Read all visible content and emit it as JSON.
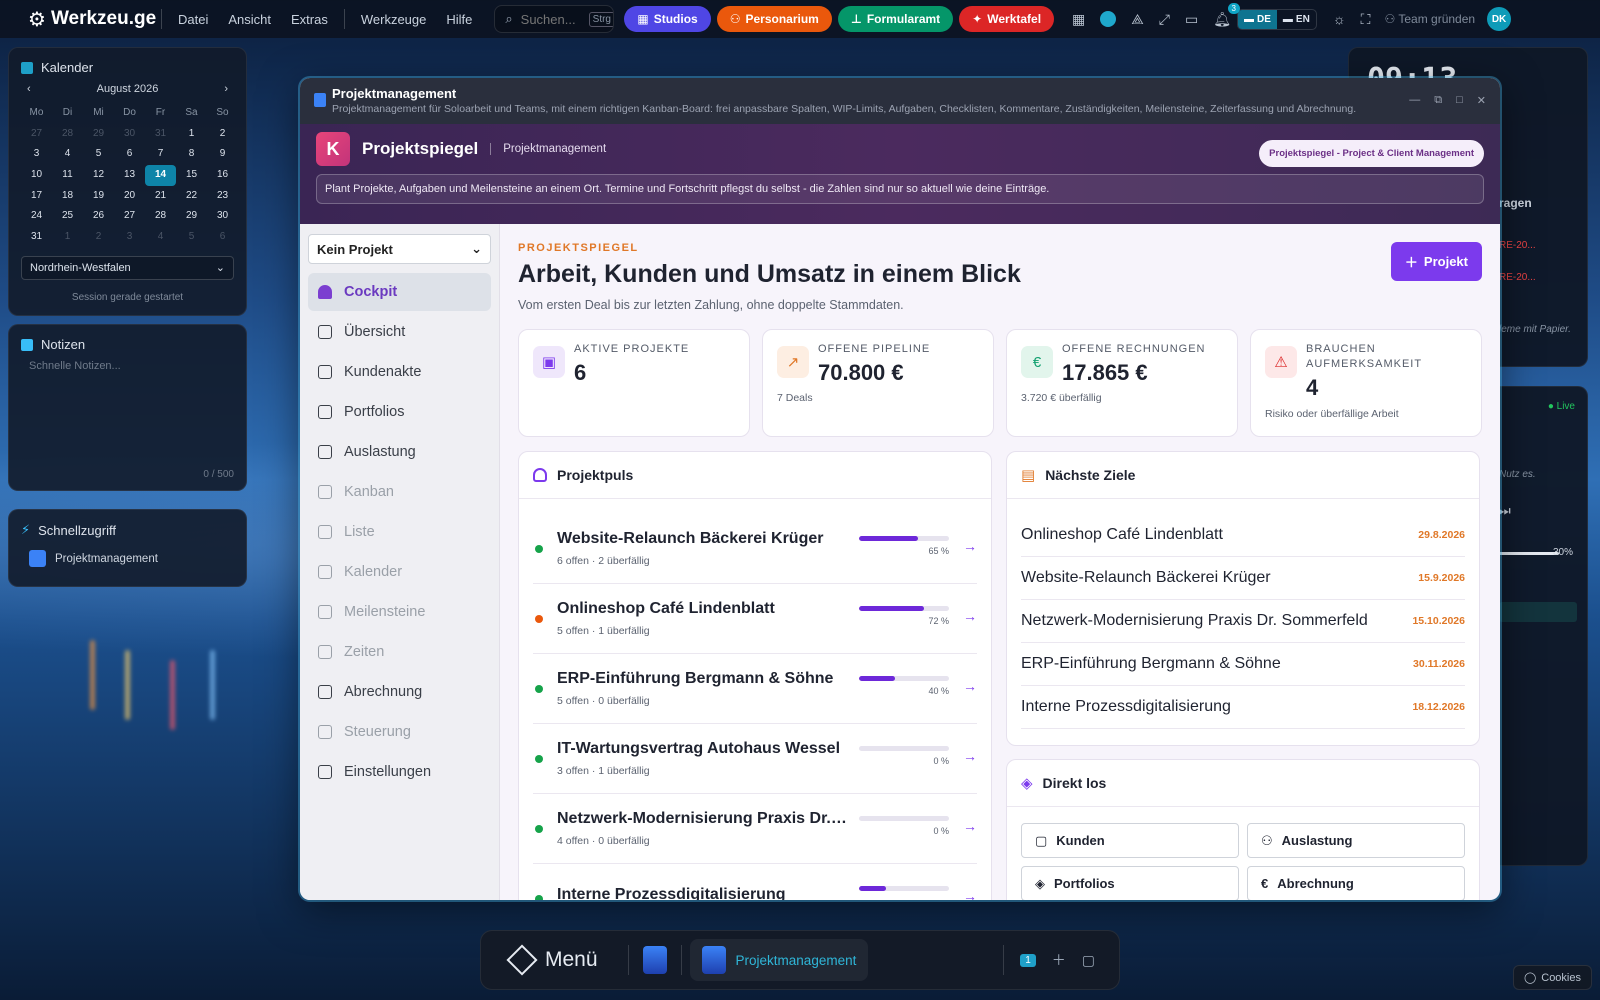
{
  "topbar": {
    "logo": "Werkzeu.ge",
    "menu": [
      "Datei",
      "Ansicht",
      "Extras",
      "Werkzeuge",
      "Hilfe"
    ],
    "search_placeholder": "Suchen...",
    "search_kbd": "Strg",
    "pills": [
      {
        "label": "Studios",
        "color": "#4f46e5"
      },
      {
        "label": "Personarium",
        "color": "#ea580c"
      },
      {
        "label": "Formularamt",
        "color": "#059669"
      },
      {
        "label": "Werktafel",
        "color": "#dc2626"
      }
    ],
    "notification_count": "3",
    "lang_de": "DE",
    "lang_en": "EN",
    "team": "Team gründen",
    "avatar": "DK"
  },
  "calendar": {
    "title": "Kalender",
    "month": "August 2026",
    "weekdays": [
      "Mo",
      "Di",
      "Mi",
      "Do",
      "Fr",
      "Sa",
      "So"
    ],
    "days": [
      "27",
      "28",
      "29",
      "30",
      "31",
      "1",
      "2",
      "3",
      "4",
      "5",
      "6",
      "7",
      "8",
      "9",
      "10",
      "11",
      "12",
      "13",
      "14",
      "15",
      "16",
      "17",
      "18",
      "19",
      "20",
      "21",
      "22",
      "23",
      "24",
      "25",
      "26",
      "27",
      "28",
      "29",
      "30",
      "31",
      "1",
      "2",
      "3",
      "4",
      "5",
      "6"
    ],
    "today": "14",
    "region": "Nordrhein-Westfalen",
    "session": "Session gerade gestartet"
  },
  "notes": {
    "title": "Notizen",
    "placeholder": "Schnelle Notizen...",
    "count": "0 / 500"
  },
  "quickaccess": {
    "title": "Schnellzugriff",
    "item": "Projektmanagement"
  },
  "right_panels": {
    "clock": "09:13",
    "fragment1": "ragen",
    "re1": "RE-20...",
    "re2": "RE-20...",
    "paper": "leme mit Papier.",
    "live": "Live",
    "nutz": "Nutz es.",
    "vol": "30%"
  },
  "window": {
    "title": "Projektmanagement",
    "subtitle": "Projektmanagement für Soloarbeit und Teams, mit einem richtigen Kanban-Board: frei anpassbare Spalten, WIP-Limits, Aufgaben, Checklisten, Kommentare, Zuständigkeiten, Meilensteine, Zeiterfassung und Abrechnung."
  },
  "app": {
    "logo_letter": "K",
    "name": "Projektspiegel",
    "section": "Projektmanagement",
    "badge": "Projektspiegel - Project & Client Management",
    "info": "Plant Projekte, Aufgaben und Meilensteine an einem Ort. Termine und Fortschritt pflegst du selbst - die Zahlen sind nur so aktuell wie deine Einträge."
  },
  "sidebar": {
    "project_select": "Kein Projekt",
    "items": [
      {
        "label": "Cockpit",
        "state": "active"
      },
      {
        "label": "Übersicht",
        "state": "normal"
      },
      {
        "label": "Kundenakte",
        "state": "normal"
      },
      {
        "label": "Portfolios",
        "state": "normal"
      },
      {
        "label": "Auslastung",
        "state": "normal"
      },
      {
        "label": "Kanban",
        "state": "dim"
      },
      {
        "label": "Liste",
        "state": "dim"
      },
      {
        "label": "Kalender",
        "state": "dim"
      },
      {
        "label": "Meilensteine",
        "state": "dim"
      },
      {
        "label": "Zeiten",
        "state": "dim"
      },
      {
        "label": "Abrechnung",
        "state": "normal"
      },
      {
        "label": "Steuerung",
        "state": "dim"
      },
      {
        "label": "Einstellungen",
        "state": "normal"
      }
    ]
  },
  "main": {
    "kicker": "PROJEKTSPIEGEL",
    "title": "Arbeit, Kunden und Umsatz in einem Blick",
    "subtitle": "Vom ersten Deal bis zur letzten Zahlung, ohne doppelte Stammdaten.",
    "new_button": "Projekt",
    "cards": [
      {
        "label": "Aktive Projekte",
        "value": "6",
        "note": "",
        "icon": "briefcase-icon",
        "glyph": "▣",
        "bg": "#efe7fb",
        "fg": "#7c3aed"
      },
      {
        "label": "Offene Pipeline",
        "value": "70.800 €",
        "note": "7 Deals",
        "icon": "trend-up-icon",
        "glyph": "↗",
        "bg": "#fdeee2",
        "fg": "#e07828"
      },
      {
        "label": "Offene Rechnungen",
        "value": "17.865 €",
        "note": "3.720 € überfällig",
        "icon": "euro-icon",
        "glyph": "€",
        "bg": "#e2f5ec",
        "fg": "#0f9f6e"
      },
      {
        "label": "Brauchen Aufmerksamkeit",
        "value": "4",
        "note": "Risiko oder überfällige Arbeit",
        "icon": "warning-icon",
        "glyph": "⚠",
        "bg": "#fde8e8",
        "fg": "#dc2626"
      }
    ],
    "pulse": {
      "title": "Projektpuls",
      "rows": [
        {
          "name": "Website-Relaunch Bäckerei Krüger",
          "meta": "6 offen · 2 überfällig",
          "progress": 65,
          "pct": "65 %",
          "color": "#16a34a"
        },
        {
          "name": "Onlineshop Café Lindenblatt",
          "meta": "5 offen · 1 überfällig",
          "progress": 72,
          "pct": "72 %",
          "color": "#ea580c"
        },
        {
          "name": "ERP-Einführung Bergmann & Söhne",
          "meta": "5 offen · 0 überfällig",
          "progress": 40,
          "pct": "40 %",
          "color": "#16a34a"
        },
        {
          "name": "IT-Wartungsvertrag Autohaus Wessel",
          "meta": "3 offen · 1 überfällig",
          "progress": 0,
          "pct": "0 %",
          "color": "#16a34a"
        },
        {
          "name": "Netzwerk-Modernisierung Praxis Dr. Sommerfeld",
          "meta": "4 offen · 0 überfällig",
          "progress": 0,
          "pct": "0 %",
          "color": "#16a34a"
        },
        {
          "name": "Interne Prozessdigitalisierung",
          "meta": "",
          "progress": 30,
          "pct": "",
          "color": "#16a34a"
        }
      ]
    },
    "goals": {
      "title": "Nächste Ziele",
      "rows": [
        {
          "name": "Onlineshop Café Lindenblatt",
          "date": "29.8.2026"
        },
        {
          "name": "Website-Relaunch Bäckerei Krüger",
          "date": "15.9.2026"
        },
        {
          "name": "Netzwerk-Modernisierung Praxis Dr. Sommerfeld",
          "date": "15.10.2026"
        },
        {
          "name": "ERP-Einführung Bergmann & Söhne",
          "date": "30.11.2026"
        },
        {
          "name": "Interne Prozessdigitalisierung",
          "date": "18.12.2026"
        }
      ]
    },
    "direct": {
      "title": "Direkt los",
      "buttons": [
        {
          "label": "Kunden",
          "glyph": "▢"
        },
        {
          "label": "Auslastung",
          "glyph": "⚇"
        },
        {
          "label": "Portfolios",
          "glyph": "◈"
        },
        {
          "label": "Abrechnung",
          "glyph": "€"
        }
      ]
    }
  },
  "taskbar": {
    "menu": "Menü",
    "active_app": "Projektmanagement",
    "workspace": "1"
  },
  "cookies": "Cookies"
}
